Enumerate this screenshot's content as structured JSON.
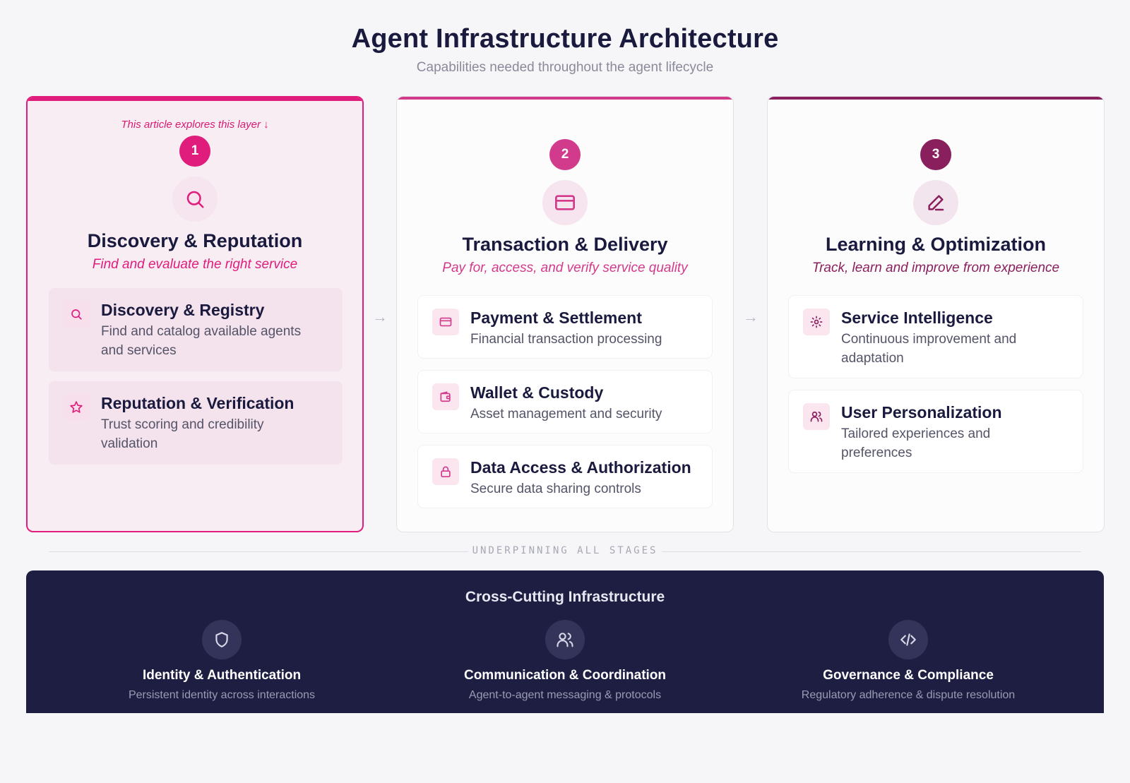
{
  "header": {
    "title": "Agent Infrastructure Architecture",
    "subtitle": "Capabilities needed throughout the agent lifecycle"
  },
  "stages": [
    {
      "note": "This article explores this layer ↓",
      "number": "1",
      "icon": "search-icon",
      "title": "Discovery & Reputation",
      "subtitle": "Find and evaluate the right service",
      "color": "#e01c7c",
      "items": [
        {
          "icon": "search-icon",
          "title": "Discovery & Registry",
          "desc_line1": "Find and catalog available agents",
          "desc_line2": "and services"
        },
        {
          "icon": "star-icon",
          "title": "Reputation & Verification",
          "desc_line1": "Trust scoring and credibility",
          "desc_line2": "validation"
        }
      ]
    },
    {
      "number": "2",
      "icon": "credit-card-icon",
      "title": "Transaction & Delivery",
      "subtitle": "Pay for, access, and verify service quality",
      "color": "#d23a8c",
      "items": [
        {
          "icon": "credit-card-icon",
          "title": "Payment & Settlement",
          "desc_line1": "Financial transaction processing"
        },
        {
          "icon": "wallet-icon",
          "title": "Wallet & Custody",
          "desc_line1": "Asset management and security"
        },
        {
          "icon": "lock-icon",
          "title": "Data Access & Authorization",
          "desc_line1": "Secure data sharing controls"
        }
      ]
    },
    {
      "number": "3",
      "icon": "pencil-icon",
      "title": "Learning & Optimization",
      "subtitle": "Track, learn and improve from experience",
      "color": "#8a1f5e",
      "items": [
        {
          "icon": "sun-gear-icon",
          "title": "Service Intelligence",
          "desc_line1": "Continuous improvement and",
          "desc_line2": "adaptation"
        },
        {
          "icon": "users-icon",
          "title": "User Personalization",
          "desc_line1": "Tailored experiences and",
          "desc_line2": "preferences"
        }
      ]
    }
  ],
  "arrows": [
    "→",
    "→"
  ],
  "divider": {
    "label": "UNDERPINNING ALL STAGES"
  },
  "infrastructure": {
    "title": "Cross-Cutting Infrastructure",
    "items": [
      {
        "icon": "shield-icon",
        "title": "Identity & Authentication",
        "desc": "Persistent identity across interactions"
      },
      {
        "icon": "users-icon",
        "title": "Communication & Coordination",
        "desc": "Agent-to-agent messaging & protocols"
      },
      {
        "icon": "code-icon",
        "title": "Governance & Compliance",
        "desc": "Regulatory adherence & dispute resolution"
      }
    ]
  }
}
